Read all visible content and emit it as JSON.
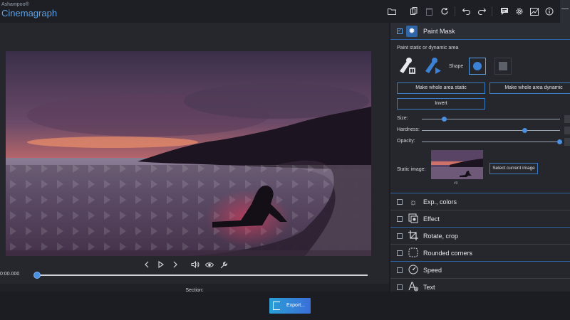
{
  "app": {
    "vendor": "Ashampoo®",
    "name": "Cinemagraph"
  },
  "toolbar": {
    "icons": [
      "folder-icon",
      "copy-icon",
      "delete-icon",
      "reload-icon",
      "undo-icon",
      "redo-icon",
      "feedback-icon",
      "settings-icon",
      "chart-icon",
      "info-icon",
      "minimize-icon"
    ]
  },
  "player": {
    "timecode": "0:00.000",
    "position": 0.0
  },
  "section": {
    "label": "Section:",
    "start": 0.0,
    "end": 1.0
  },
  "paint_mask": {
    "title": "Paint Mask",
    "enabled": true,
    "subtitle": "Paint static or dynamic area",
    "shape_label": "Shape",
    "selected_shape": "circle",
    "make_static": "Make whole area static",
    "make_dynamic": "Make whole area dynamic",
    "invert": "Invert",
    "sliders": [
      {
        "label": "Size:",
        "value": 0.16
      },
      {
        "label": "Hardness:",
        "value": 0.75
      },
      {
        "label": "Opacity:",
        "value": 1.0
      }
    ],
    "static_image_label": "Static image:",
    "frame_caption": "#0",
    "select_image": "Select current image"
  },
  "effects": [
    {
      "label": "Exp., colors",
      "icon": "sun-icon",
      "checked": false
    },
    {
      "label": "Effect",
      "icon": "effect-icon",
      "checked": false
    },
    {
      "label": "Rotate, crop",
      "icon": "crop-icon",
      "checked": false
    },
    {
      "label": "Rounded corners",
      "icon": "rounded-corners-icon",
      "checked": false
    },
    {
      "label": "Speed",
      "icon": "speedometer-icon",
      "checked": false
    },
    {
      "label": "Text",
      "icon": "text-icon",
      "checked": false
    }
  ],
  "export_label": "Export...",
  "colors": {
    "accent": "#3b7cc4",
    "brand": "#5aa0e6",
    "section_start": "#1fb6a8",
    "section_end": "#5a67d8"
  }
}
